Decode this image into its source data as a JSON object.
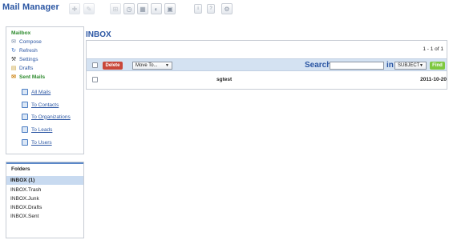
{
  "app": {
    "title": "Mail Manager"
  },
  "toolbar_icons": [
    {
      "name": "add-icon",
      "glyph": "✚"
    },
    {
      "name": "edit-icon",
      "glyph": "✎"
    },
    {
      "name": "import-icon",
      "glyph": "⊞"
    },
    {
      "name": "clock-icon",
      "glyph": "◷"
    },
    {
      "name": "calculator-icon",
      "glyph": "▦"
    },
    {
      "name": "chat-icon",
      "glyph": "◐"
    },
    {
      "name": "tag-icon",
      "glyph": "▣"
    },
    {
      "name": "info-icon",
      "glyph": "i"
    },
    {
      "name": "help-icon",
      "glyph": "?"
    },
    {
      "name": "settings-icon",
      "glyph": "⚙"
    }
  ],
  "sidebar": {
    "header": "Mailbox",
    "items": [
      {
        "label": "Compose",
        "icon": "✉"
      },
      {
        "label": "Refresh",
        "icon": "↻"
      },
      {
        "label": "Settings",
        "icon": "⚒"
      },
      {
        "label": "Drafts",
        "icon": "▤"
      },
      {
        "label": "Sent Mails",
        "icon": "✉"
      }
    ],
    "sent_links": [
      "All Mails",
      "To Contacts",
      "To Organizations",
      "To Leads",
      "To Users"
    ]
  },
  "folders": {
    "title": "Folders",
    "items": [
      "INBOX (1)",
      "INBOX.Trash",
      "INBOX.Junk",
      "INBOX.Drafts",
      "INBOX.Sent"
    ],
    "active_index": 0
  },
  "main": {
    "title": "INBOX",
    "pager": "1 - 1 of 1",
    "delete_label": "Delete",
    "move_to": "Move To...",
    "search_label": "Search",
    "search_value": "",
    "in_label": "in",
    "search_field": "SUBJECT",
    "find_label": "Find",
    "mails": [
      {
        "subject": "sgtest",
        "date": "2011-10-20"
      }
    ]
  },
  "colors": {
    "accent": "#2b56a3",
    "green": "#2d8a2d",
    "toolbar_bg": "#d4e2f2",
    "delete": "#c9473a",
    "find": "#7ec83f"
  }
}
